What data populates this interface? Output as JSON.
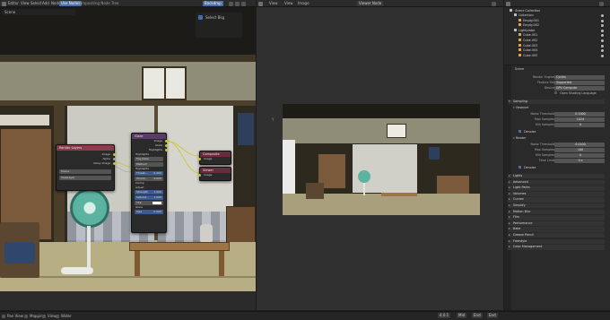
{
  "header": {
    "menus": [
      "Editor",
      "View",
      "Select",
      "Add",
      "Node",
      "Use Nodes"
    ],
    "node_tree_label": "Compositing Node Tree",
    "scene_pill": "Scene",
    "backdrop_label": "Backdrop",
    "slot_label": "Select Bkg"
  },
  "viewer_header": {
    "menus": [
      "View",
      "View",
      "Image"
    ],
    "image_name": "Viewer Node",
    "axis_label": "Y"
  },
  "nodes": {
    "render_layers": {
      "title": "Render Layers",
      "outputs": [
        "Image",
        "Alpha",
        "Noisy Image"
      ],
      "scene": "Scene",
      "layer": "ViewLayer"
    },
    "glare": {
      "title": "Glare",
      "outputs": [
        "Image",
        "Glare",
        "Highlights"
      ],
      "in_highlights": "Highlights",
      "type": "Fog Glow",
      "quality": "Medium",
      "highlights_label": "Highlights",
      "threshold_label": "Thresh...",
      "threshold_value": "0.200",
      "smoothness_label": "Smoot...",
      "smoothness_value": "0.000",
      "clamp_label": "Clamp",
      "adjust_label": "Adjust",
      "strength_label": "Strength",
      "strength_value": "1.000",
      "saturation_label": "Saturat...",
      "saturation_value": "1.000",
      "tint_label": "Tint",
      "glare_label": "Glare",
      "size_label": "Size",
      "size_value": "0.500",
      "image_in": "Image"
    },
    "composite": {
      "title": "Composite",
      "inputs": [
        "Image"
      ]
    },
    "viewer": {
      "title": "Viewer",
      "inputs": [
        "Image"
      ]
    }
  },
  "outliner": {
    "title": "Scene Collection",
    "items": [
      {
        "label": "Collection",
        "indent": 1
      },
      {
        "label": "Empty.001",
        "indent": 2
      },
      {
        "label": "Empty.002",
        "indent": 2
      },
      {
        "label": "Lightprobe",
        "indent": 1
      },
      {
        "label": "Cube.001",
        "indent": 2
      },
      {
        "label": "Cube.002",
        "indent": 2
      },
      {
        "label": "Cube.003",
        "indent": 2
      },
      {
        "label": "Cube.004",
        "indent": 2
      },
      {
        "label": "Cube.005",
        "indent": 2
      }
    ]
  },
  "properties": {
    "tab_label": "Scene",
    "render_engine_label": "Render Engine",
    "render_engine_value": "Cycles",
    "feature_set_label": "Feature Set",
    "feature_set_value": "Supported",
    "device_label": "Device",
    "device_value": "GPU Compute",
    "osl_label": "Open Shading Language",
    "sampling_label": "Sampling",
    "viewport_label": "Viewport",
    "noise_threshold_label": "Noise Threshold",
    "viewport_noise_value": "0.1000",
    "max_samples_label": "Max Samples",
    "viewport_max_samples": "1024",
    "min_samples_label": "Min Samples",
    "viewport_min_samples": "0",
    "denoise_label": "Denoise",
    "render_label": "Render",
    "render_noise_value": "0.0100",
    "render_max_samples": "100",
    "render_min_samples": "0",
    "time_limit_label": "Time Limit",
    "time_limit_value": "0 s",
    "render_denoise_label": "Denoise",
    "sections": [
      "Lights",
      "Advanced",
      "Light Paths",
      "Volumes",
      "Curves",
      "Simplify",
      "Motion Blur",
      "Film",
      "Performance",
      "Bake",
      "Grease Pencil",
      "Freestyle",
      "Color Management"
    ]
  },
  "statusbar": {
    "left": [
      "Pan View",
      "Mapping",
      "View",
      "Wider"
    ],
    "right": [
      "4.0.1",
      "Mid",
      "End",
      "End"
    ]
  },
  "colors": {
    "accent": "#4a6fa5",
    "node_header_red": "#8b3b4a",
    "node_header_purple": "#5a3a66",
    "node_header_output": "#6b2b3e"
  }
}
